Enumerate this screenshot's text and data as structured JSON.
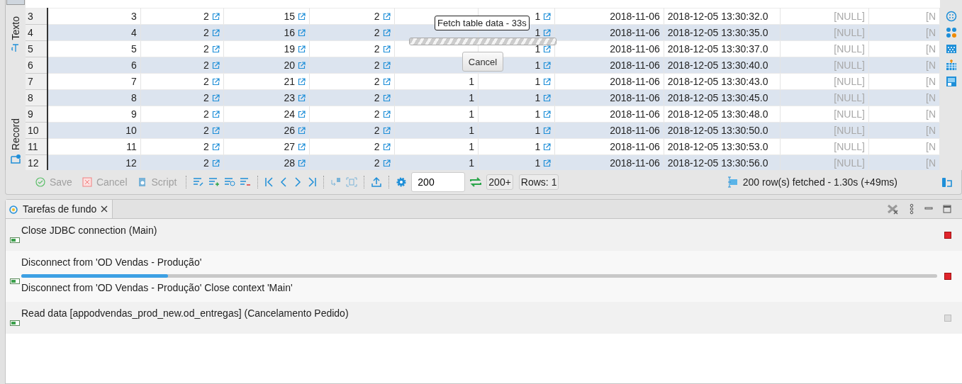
{
  "vertical_tabs": [
    {
      "label": "Texto",
      "selected": false
    },
    {
      "label": "Record",
      "selected": false
    }
  ],
  "table": {
    "columns": [
      {
        "kind": "number"
      },
      {
        "kind": "link"
      },
      {
        "kind": "link"
      },
      {
        "kind": "link"
      },
      {
        "kind": "number"
      },
      {
        "kind": "link"
      },
      {
        "kind": "number"
      },
      {
        "kind": "text"
      },
      {
        "kind": "null"
      },
      {
        "kind": "null"
      }
    ],
    "rows": [
      {
        "number": "3",
        "cells": [
          "3",
          "2",
          "15",
          "2",
          null,
          "1",
          "2018-11-06",
          "2018-12-05 13:30:32.0",
          "[NULL]",
          "[N"
        ]
      },
      {
        "number": "4",
        "cells": [
          "4",
          "2",
          "16",
          "2",
          null,
          "1",
          "2018-11-06",
          "2018-12-05 13:30:35.0",
          "[NULL]",
          "[N"
        ]
      },
      {
        "number": "5",
        "cells": [
          "5",
          "2",
          "19",
          "2",
          null,
          "1",
          "2018-11-06",
          "2018-12-05 13:30:37.0",
          "[NULL]",
          "[N"
        ]
      },
      {
        "number": "6",
        "cells": [
          "6",
          "2",
          "20",
          "2",
          null,
          "1",
          "2018-11-06",
          "2018-12-05 13:30:40.0",
          "[NULL]",
          "[N"
        ]
      },
      {
        "number": "7",
        "cells": [
          "7",
          "2",
          "21",
          "2",
          "1",
          "1",
          "2018-11-06",
          "2018-12-05 13:30:43.0",
          "[NULL]",
          "[N"
        ]
      },
      {
        "number": "8",
        "cells": [
          "8",
          "2",
          "23",
          "2",
          "1",
          "1",
          "2018-11-06",
          "2018-12-05 13:30:45.0",
          "[NULL]",
          "[N"
        ]
      },
      {
        "number": "9",
        "cells": [
          "9",
          "2",
          "24",
          "2",
          "1",
          "1",
          "2018-11-06",
          "2018-12-05 13:30:48.0",
          "[NULL]",
          "[N"
        ]
      },
      {
        "number": "10",
        "cells": [
          "10",
          "2",
          "26",
          "2",
          "1",
          "1",
          "2018-11-06",
          "2018-12-05 13:30:50.0",
          "[NULL]",
          "[N"
        ]
      },
      {
        "number": "11",
        "cells": [
          "11",
          "2",
          "27",
          "2",
          "1",
          "1",
          "2018-11-06",
          "2018-12-05 13:30:53.0",
          "[NULL]",
          "[N"
        ]
      },
      {
        "number": "12",
        "cells": [
          "12",
          "2",
          "28",
          "2",
          "1",
          "1",
          "2018-11-06",
          "2018-12-05 13:30:56.0",
          "[NULL]",
          "[N"
        ]
      }
    ]
  },
  "progress_popup": {
    "label": "Fetch table data - 33s",
    "level": 1,
    "cancel": "Cancel"
  },
  "toolbar": {
    "buttons": [
      {
        "label": "Save",
        "kind": "save",
        "disabled": true
      },
      {
        "label": "Cancel",
        "kind": "cancel",
        "disabled": true
      },
      {
        "label": "Script",
        "kind": "script",
        "disabled": true
      }
    ],
    "fetch_size": "200",
    "fetch_more": "200+",
    "rows": "Rows: 1",
    "status": "200 row(s) fetched - 1.30s (+49ms)"
  },
  "bottom_panel": {
    "tab": {
      "label": "Tarefas de fundo",
      "selected": true
    },
    "tasks": [
      {
        "title": "Close JDBC connection (Main)",
        "stop_enabled": true
      },
      {
        "title": "Disconnect from 'OD Vendas - Produção'",
        "level": 0.16,
        "detail": "Disconnect from 'OD Vendas - Produção' Close context 'Main'",
        "stop_enabled": true
      },
      {
        "title": "Read data [appodvendas_prod_new.od_entregas] (Cancelamento Pedido)",
        "stop_enabled": false
      }
    ]
  }
}
